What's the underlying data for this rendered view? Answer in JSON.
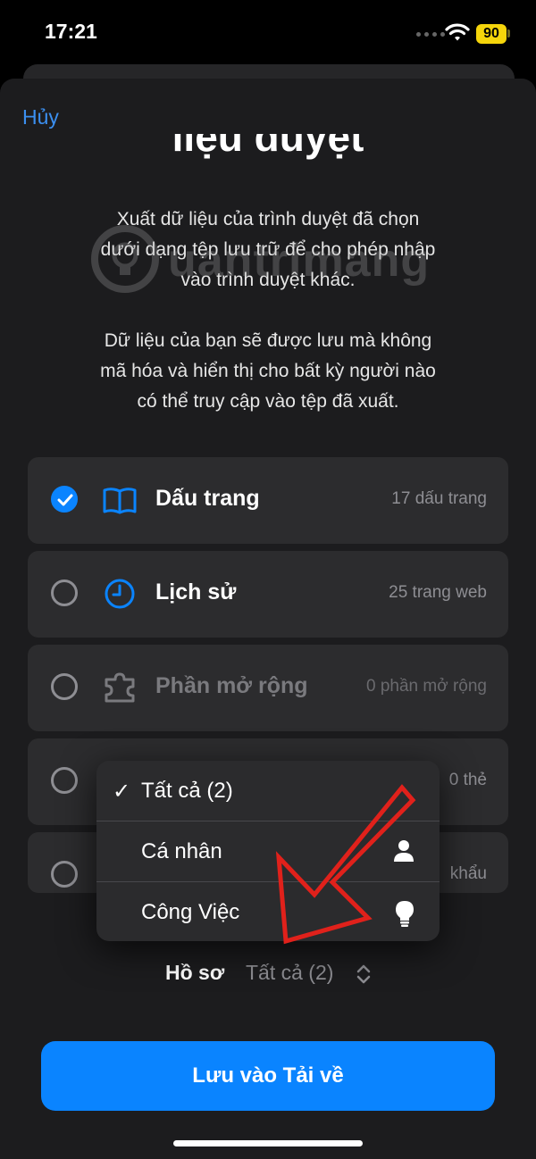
{
  "status": {
    "time": "17:21",
    "battery": "90"
  },
  "header": {
    "cancel_label": "Hủy",
    "title_fragment": "liệu duyệt"
  },
  "watermark": {
    "text": "uantrimang"
  },
  "description": {
    "line1": "Xuất dữ liệu của trình duyệt đã chọn",
    "line2": "dưới dạng tệp lưu trữ để cho phép nhập",
    "line3": "vào trình duyệt khác.",
    "line4": "Dữ liệu của bạn sẽ được lưu mà không",
    "line5": "mã hóa và hiển thị cho bất kỳ người nào",
    "line6": "có thể truy cập vào tệp đã xuất."
  },
  "rows": [
    {
      "label": "Dấu trang",
      "count": "17 dấu trang",
      "checked": true,
      "icon": "book-icon"
    },
    {
      "label": "Lịch sử",
      "count": "25 trang web",
      "checked": false,
      "icon": "clock-icon"
    },
    {
      "label": "Phần mở rộng",
      "count": "0 phần mở rộng",
      "checked": false,
      "icon": "puzzle-icon"
    },
    {
      "label": "",
      "count": "0 thẻ",
      "checked": false
    },
    {
      "label": "",
      "count": "khẩu",
      "checked": false
    }
  ],
  "menu": {
    "items": [
      {
        "label": "Tất cả (2)",
        "checked": true
      },
      {
        "label": "Cá nhân",
        "icon": "person-icon"
      },
      {
        "label": "Công Việc",
        "icon": "lightbulb-icon"
      }
    ]
  },
  "profile": {
    "label": "Hồ sơ",
    "value": "Tất cả (2)"
  },
  "save_button": {
    "label": "Lưu vào Tải về"
  },
  "colors": {
    "accent": "#0a84ff",
    "sheet": "#1c1c1e",
    "row": "#2c2c2e",
    "arrow": "#e0211b"
  }
}
